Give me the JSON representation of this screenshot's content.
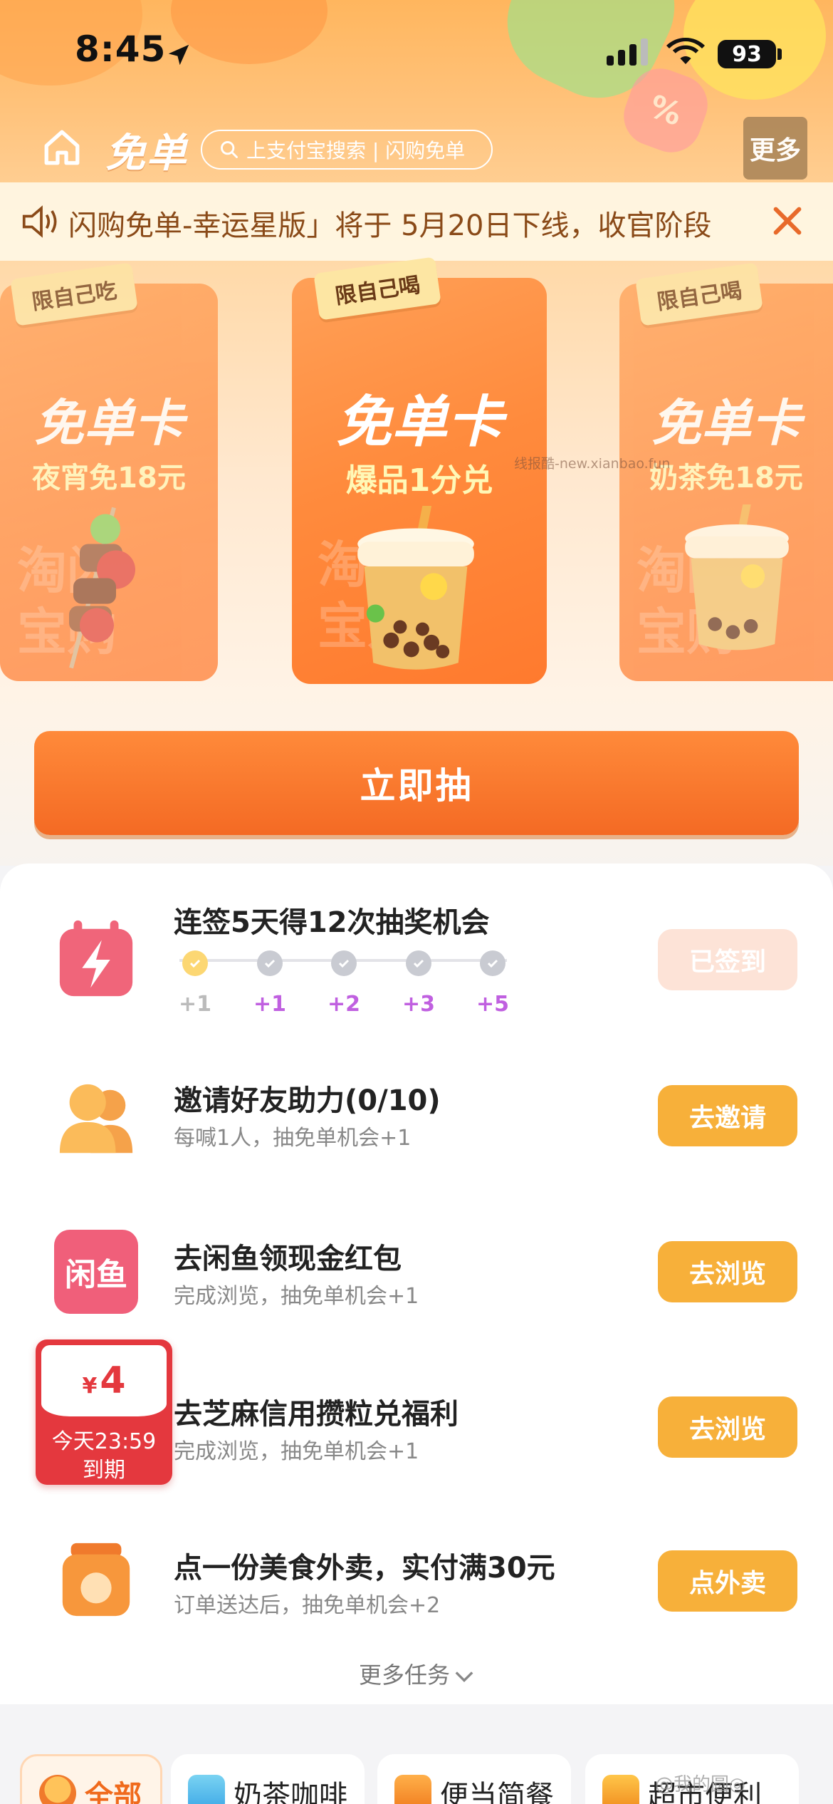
{
  "status_bar": {
    "time": "8:45",
    "battery": "93"
  },
  "nav": {
    "brand": "免单",
    "search_text": "上支付宝搜索 | 闪购免单",
    "more_label": "更多"
  },
  "notice": {
    "text": "闪购免单-幸运星版」将于 5月20日下线，收官阶段"
  },
  "cards": [
    {
      "tag": "限自己吃",
      "title": "免单卡",
      "subtitle": "夜宵免18元"
    },
    {
      "tag": "限自己喝",
      "title": "免单卡",
      "subtitle": "爆品1分兑"
    },
    {
      "tag": "限自己喝",
      "title": "免单卡",
      "subtitle": "奶茶免18元"
    }
  ],
  "card_watermark": {
    "line1": "淘闪",
    "line2": "宝购"
  },
  "source_watermark": "线报酷-new.xianbao.fun",
  "draw_button": "立即抽",
  "checkin": {
    "title": "连签5天得12次抽奖机会",
    "button": "已签到",
    "rewards": [
      "+1",
      "+1",
      "+2",
      "+3",
      "+5"
    ]
  },
  "tasks": [
    {
      "title": "邀请好友助力(0/10)",
      "subtitle": "每喊1人，抽免单机会+1",
      "button": "去邀请"
    },
    {
      "title": "去闲鱼领现金红包",
      "subtitle": "完成浏览，抽免单机会+1",
      "button": "去浏览",
      "icon_text": "闲鱼"
    },
    {
      "title": "去芝麻信用攒粒兑福利",
      "subtitle": "完成浏览，抽免单机会+1",
      "button": "去浏览"
    },
    {
      "title": "点一份美食外卖，实付满30元",
      "subtitle": "订单送达后，抽免单机会+2",
      "button": "点外卖"
    }
  ],
  "coupon": {
    "currency": "¥",
    "amount": "4",
    "line1": "今天23:59",
    "line2": "到期"
  },
  "more_tasks": "更多任务",
  "categories": [
    "全部",
    "奶茶咖啡",
    "便当简餐",
    "超市便利"
  ],
  "bottom_watermark": "@我的圆◎",
  "colors": {
    "accent": "#f46a24",
    "button_yellow": "#f7b03a",
    "coupon_red": "#e4383e"
  }
}
